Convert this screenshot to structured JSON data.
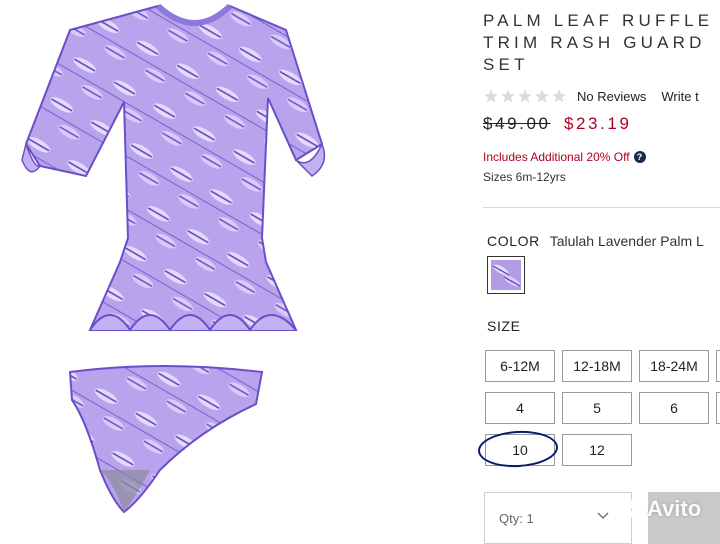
{
  "product": {
    "title_line1": "PALM LEAF RUFFLE",
    "title_line2": "TRIM RASH GUARD",
    "title_line3": "SET",
    "rating": {
      "stars_filled": 0,
      "stars_total": 5,
      "reviews_text": "No Reviews",
      "write_review": "Write t"
    },
    "old_price": "$49.00",
    "new_price": "$23.19",
    "promo": "Includes Additional 20% Off",
    "help_icon": "?",
    "sizes_note": "Sizes 6m-12yrs"
  },
  "color": {
    "label": "COLOR",
    "value": "Talulah Lavender Palm L",
    "swatch_color": "#b49be6"
  },
  "size": {
    "label": "SIZE",
    "options": [
      "6-12M",
      "12-18M",
      "18-24M",
      "4",
      "5",
      "6",
      "10",
      "12"
    ],
    "circled": "10"
  },
  "quantity": {
    "label": "Qty: 1"
  },
  "watermark": {
    "text": "Avito"
  },
  "colors": {
    "accent_red": "#b00020",
    "garment": "#a88fe0",
    "garment_dark": "#5a3fb8"
  }
}
